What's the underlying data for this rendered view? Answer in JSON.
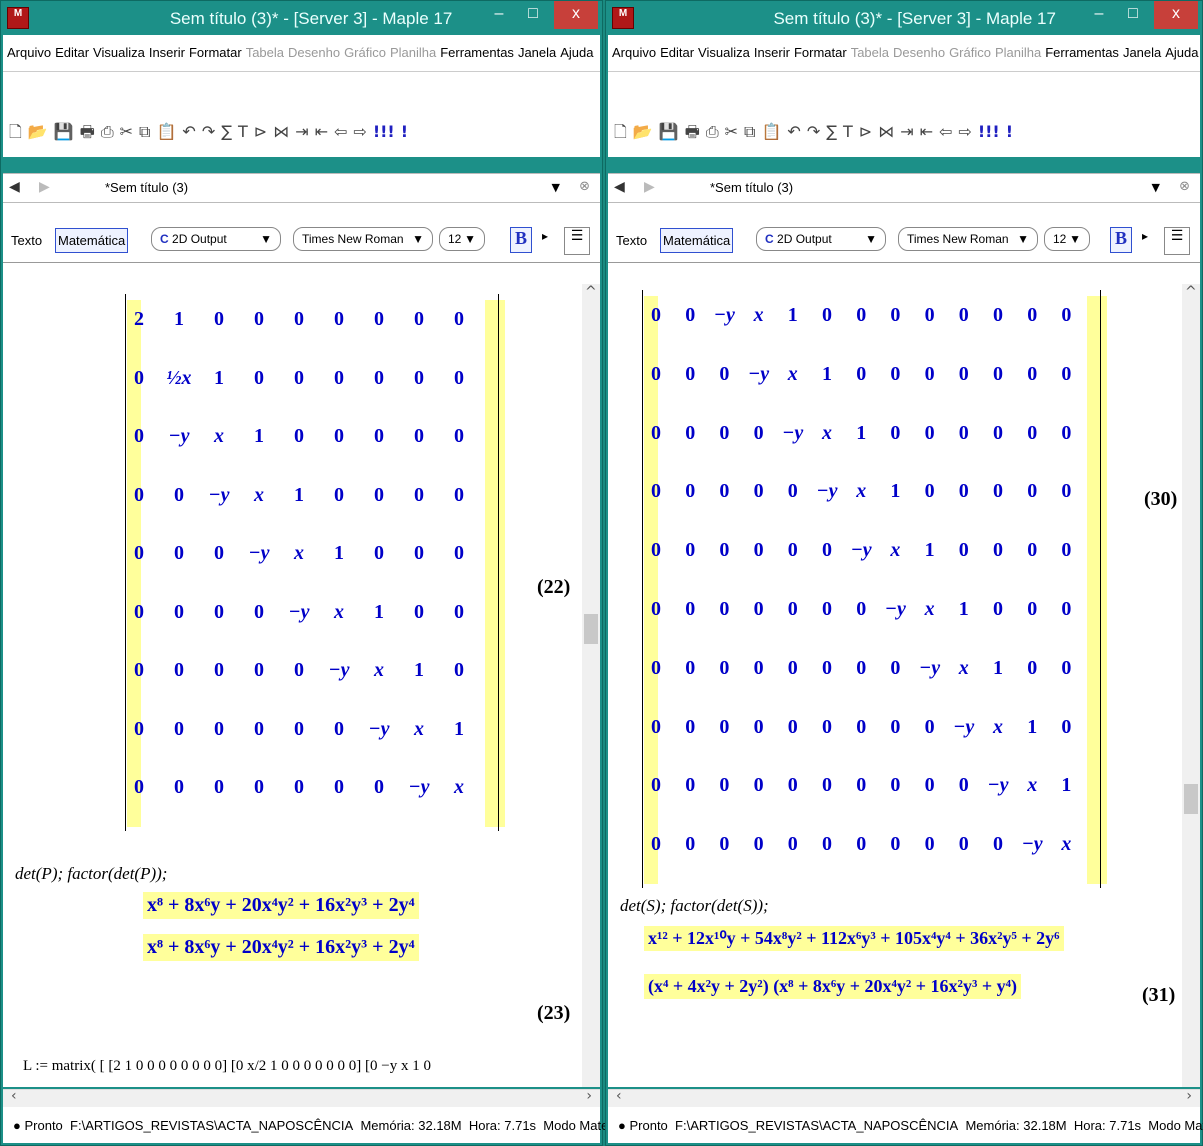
{
  "app_title": "Sem título (3)* - [Server 3] - Maple 17",
  "menus": [
    {
      "label": "Arquivo",
      "dis": false
    },
    {
      "label": "Editar",
      "dis": false
    },
    {
      "label": "Visualiza",
      "dis": false
    },
    {
      "label": "Inserir",
      "dis": false
    },
    {
      "label": "Formatar",
      "dis": false
    },
    {
      "label": "Tabela",
      "dis": true
    },
    {
      "label": "Desenho",
      "dis": true
    },
    {
      "label": "Gráfico",
      "dis": true
    },
    {
      "label": "Planilha",
      "dis": true
    },
    {
      "label": "Ferramentas",
      "dis": false
    },
    {
      "label": "Janela",
      "dis": false
    },
    {
      "label": "Ajuda",
      "dis": false
    }
  ],
  "tab_label": "*Sem título (3)",
  "format": {
    "text_mode": "Texto",
    "math_mode": "Matemática",
    "style": "2D Output",
    "font": "Times New Roman",
    "size": "12",
    "bold": "B"
  },
  "status": {
    "state": "Pronto",
    "path": "F:\\ARTIGOS_REVISTAS\\ACTA_NAPOSCÊNCIA",
    "memory": "Memória: 32.18M",
    "time": "Hora: 7.71s",
    "mode": "Modo Matemática"
  },
  "left": {
    "matrix": [
      [
        "2",
        "1",
        "0",
        "0",
        "0",
        "0",
        "0",
        "0",
        "0"
      ],
      [
        "0",
        "½x",
        "1",
        "0",
        "0",
        "0",
        "0",
        "0",
        "0"
      ],
      [
        "0",
        "−y",
        "x",
        "1",
        "0",
        "0",
        "0",
        "0",
        "0"
      ],
      [
        "0",
        "0",
        "−y",
        "x",
        "1",
        "0",
        "0",
        "0",
        "0"
      ],
      [
        "0",
        "0",
        "0",
        "−y",
        "x",
        "1",
        "0",
        "0",
        "0"
      ],
      [
        "0",
        "0",
        "0",
        "0",
        "−y",
        "x",
        "1",
        "0",
        "0"
      ],
      [
        "0",
        "0",
        "0",
        "0",
        "0",
        "−y",
        "x",
        "1",
        "0"
      ],
      [
        "0",
        "0",
        "0",
        "0",
        "0",
        "0",
        "−y",
        "x",
        "1"
      ],
      [
        "0",
        "0",
        "0",
        "0",
        "0",
        "0",
        "0",
        "−y",
        "x"
      ]
    ],
    "eq_label": "(22)",
    "command": "det(P); factor(det(P));",
    "out1": "x⁸ + 8x⁶y + 20x⁴y² + 16x²y³ + 2y⁴",
    "out2": "x⁸ + 8x⁶y + 20x⁴y² + 16x²y³ + 2y⁴",
    "out_label": "(23)",
    "partial_line": "L := matrix( [ [2 1 0 0 0 0 0 0 0 0] [0 x/2 1 0 0 0 0 0 0 0] [0 −y x 1 0"
  },
  "right": {
    "matrix": [
      [
        "0",
        "0",
        "−y",
        "x",
        "1",
        "0",
        "0",
        "0",
        "0",
        "0",
        "0",
        "0",
        "0"
      ],
      [
        "0",
        "0",
        "0",
        "−y",
        "x",
        "1",
        "0",
        "0",
        "0",
        "0",
        "0",
        "0",
        "0"
      ],
      [
        "0",
        "0",
        "0",
        "0",
        "−y",
        "x",
        "1",
        "0",
        "0",
        "0",
        "0",
        "0",
        "0"
      ],
      [
        "0",
        "0",
        "0",
        "0",
        "0",
        "−y",
        "x",
        "1",
        "0",
        "0",
        "0",
        "0",
        "0"
      ],
      [
        "0",
        "0",
        "0",
        "0",
        "0",
        "0",
        "−y",
        "x",
        "1",
        "0",
        "0",
        "0",
        "0"
      ],
      [
        "0",
        "0",
        "0",
        "0",
        "0",
        "0",
        "0",
        "−y",
        "x",
        "1",
        "0",
        "0",
        "0"
      ],
      [
        "0",
        "0",
        "0",
        "0",
        "0",
        "0",
        "0",
        "0",
        "−y",
        "x",
        "1",
        "0",
        "0"
      ],
      [
        "0",
        "0",
        "0",
        "0",
        "0",
        "0",
        "0",
        "0",
        "0",
        "−y",
        "x",
        "1",
        "0"
      ],
      [
        "0",
        "0",
        "0",
        "0",
        "0",
        "0",
        "0",
        "0",
        "0",
        "0",
        "−y",
        "x",
        "1"
      ],
      [
        "0",
        "0",
        "0",
        "0",
        "0",
        "0",
        "0",
        "0",
        "0",
        "0",
        "0",
        "−y",
        "x"
      ]
    ],
    "eq_label": "(30)",
    "command": "det(S); factor(det(S));",
    "out1": "x¹² + 12x¹⁰y + 54x⁸y² + 112x⁶y³ + 105x⁴y⁴ + 36x²y⁵ + 2y⁶",
    "out2": "(x⁴ + 4x²y + 2y²) (x⁸ + 8x⁶y + 20x⁴y² + 16x²y³ + y⁴)",
    "out_label": "(31)"
  }
}
